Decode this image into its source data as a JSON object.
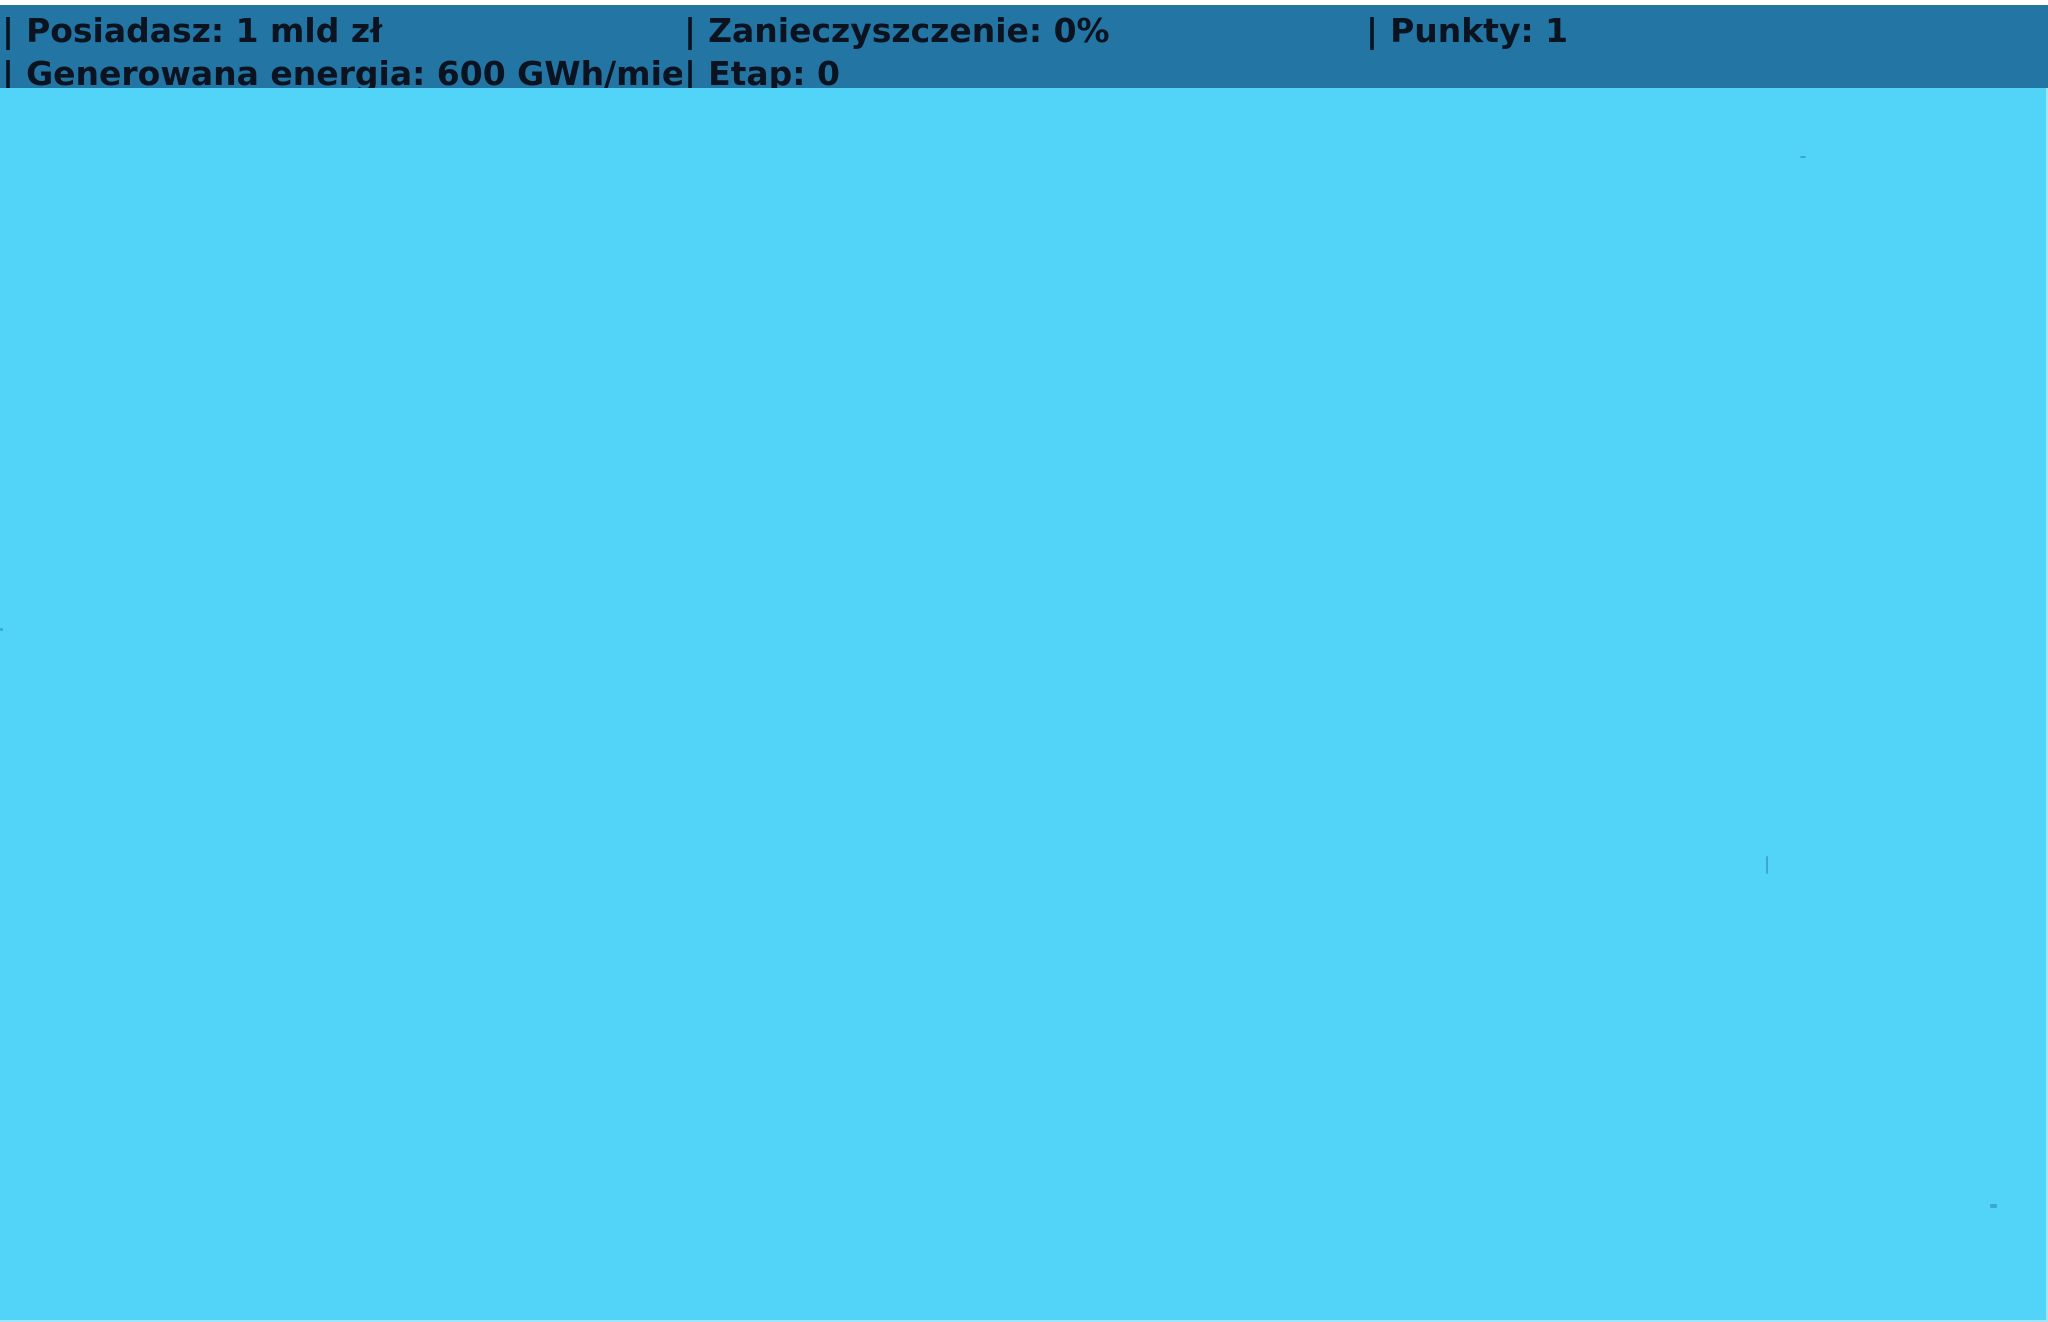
{
  "hud": {
    "separator": "|",
    "money": "Posiadasz: 1 mld zł",
    "pollution": "Zanieczyszczenie: 0%",
    "points": "Punkty: 1",
    "energy": "Generowana energia: 600 GWh/mie...",
    "stage": "Etap: 0"
  },
  "colors": {
    "status_bar": "#2375a4",
    "play_area": "#52d4f8",
    "text": "#0b1320"
  }
}
